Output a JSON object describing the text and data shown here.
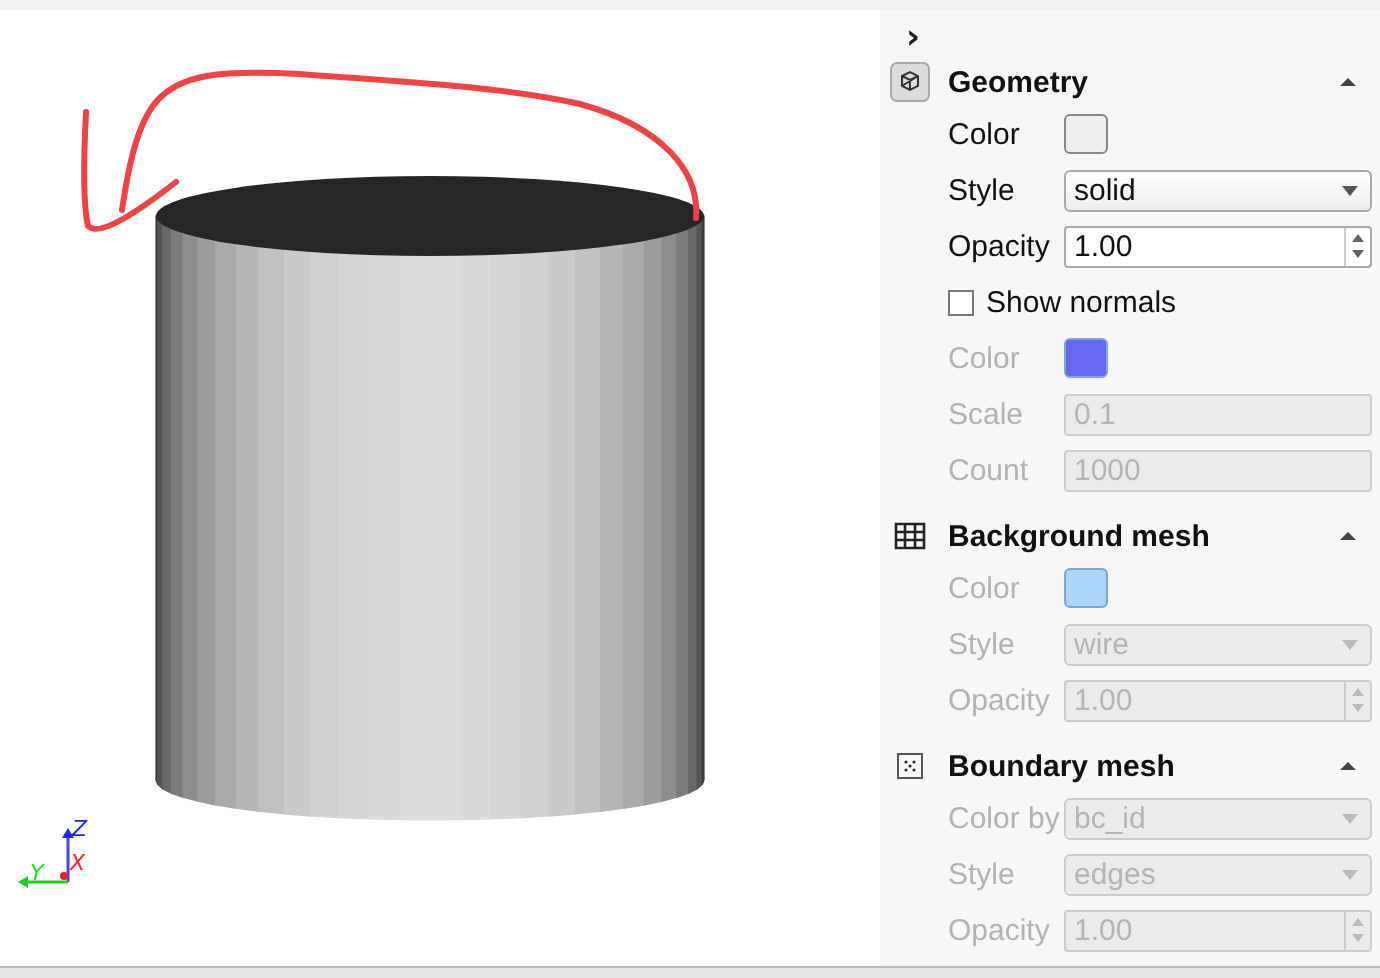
{
  "viewport": {
    "axes": [
      {
        "label": "Z"
      },
      {
        "label": "X"
      },
      {
        "label": "Y"
      }
    ]
  },
  "panel": {
    "collapse_toggle": "›",
    "sections": [
      {
        "title": "Geometry",
        "expanded": true,
        "rows": [
          {
            "kind": "color",
            "label": "Color",
            "color": "#eeeeee",
            "disabled": false
          },
          {
            "kind": "select",
            "label": "Style",
            "value": "solid",
            "disabled": false
          },
          {
            "kind": "spin",
            "label": "Opacity",
            "value": "1.00",
            "disabled": false
          },
          {
            "kind": "checkbox",
            "label": "Show normals",
            "checked": false,
            "disabled": false
          },
          {
            "kind": "color",
            "label": "Color",
            "color": "#6666ee",
            "disabled": true
          },
          {
            "kind": "text",
            "label": "Scale",
            "value": "0.1",
            "disabled": true
          },
          {
            "kind": "text",
            "label": "Count",
            "value": "1000",
            "disabled": true
          }
        ]
      },
      {
        "title": "Background mesh",
        "expanded": true,
        "rows": [
          {
            "kind": "color",
            "label": "Color",
            "color": "#aad4f8",
            "disabled": true
          },
          {
            "kind": "select",
            "label": "Style",
            "value": "wire",
            "disabled": true
          },
          {
            "kind": "spin",
            "label": "Opacity",
            "value": "1.00",
            "disabled": true
          }
        ]
      },
      {
        "title": "Boundary mesh",
        "expanded": true,
        "rows": [
          {
            "kind": "select",
            "label": "Color by",
            "value": "bc_id",
            "disabled": true
          },
          {
            "kind": "select",
            "label": "Style",
            "value": "edges",
            "disabled": true
          },
          {
            "kind": "spin",
            "label": "Opacity",
            "value": "1.00",
            "disabled": true
          }
        ]
      }
    ]
  }
}
